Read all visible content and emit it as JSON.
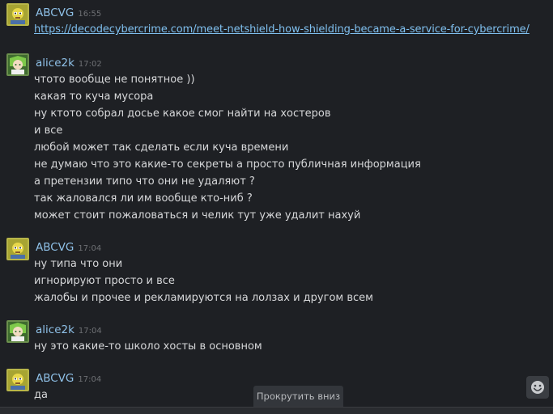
{
  "colors": {
    "background": "#1e2024",
    "username": "#8fc1e8",
    "text": "#d6d7d9",
    "link": "#7fbfee",
    "timestamp": "#6e7074"
  },
  "messages": [
    {
      "author": "ABCVG",
      "time": "16:55",
      "avatar": "abcvg-avatar",
      "lines": [
        "https://decodecybercrime.com/meet-netshield-how-shielding-became-a-service-for-cybercrime/"
      ]
    },
    {
      "author": "alice2k",
      "time": "17:02",
      "avatar": "alice2k-avatar",
      "lines": [
        "чтото вообще не понятное ))",
        "какая то куча мусора",
        "ну ктото собрал досье какое смог найти на хостеров",
        "и все",
        "любой может так сделать если куча времени",
        "не думаю что это какие-то секреты а просто публичная информация",
        "а претензии типо что они не удаляют ?",
        "так жаловался ли им вообще кто-ниб ?",
        "может стоит пожаловаться и челик тут уже удалит нахуй"
      ]
    },
    {
      "author": "ABCVG",
      "time": "17:04",
      "avatar": "abcvg-avatar",
      "lines": [
        "ну типа что они",
        "игнорируют просто и все",
        "жалобы и прочее и рекламируются на лолзах и другом всем"
      ]
    },
    {
      "author": "alice2k",
      "time": "17:04",
      "avatar": "alice2k-avatar",
      "lines": [
        "ну это какие-то школо хосты в основном"
      ]
    },
    {
      "author": "ABCVG",
      "time": "17:04",
      "avatar": "abcvg-avatar",
      "lines": [
        "да"
      ]
    }
  ],
  "scroll_button": {
    "label": "Прокрутить вниз"
  },
  "emoji_button": {
    "icon": "emoji-smiley-icon"
  }
}
